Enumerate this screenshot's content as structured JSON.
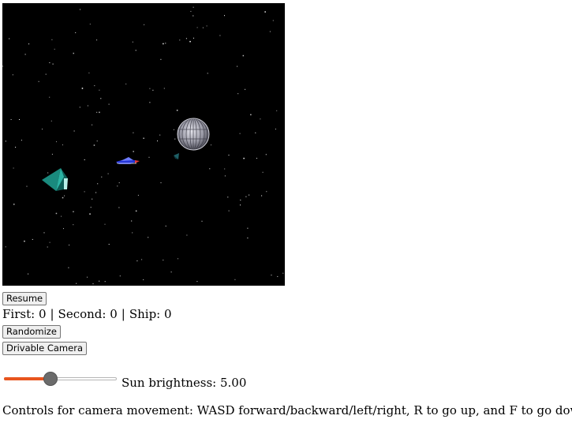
{
  "viewport": {
    "background_color": "#000000",
    "objects": [
      "planet",
      "ship",
      "pyramid",
      "small-pyramid"
    ]
  },
  "buttons": {
    "resume": "Resume",
    "randomize": "Randomize",
    "drivable_camera": "Drivable Camera"
  },
  "scores": {
    "first_label": "First:",
    "first_value": "0",
    "second_label": "Second:",
    "second_value": "0",
    "ship_label": "Ship:",
    "ship_value": "0",
    "separator": "|"
  },
  "sun": {
    "label": "Sun brightness: 5.00",
    "value": 5.0,
    "slider_fraction": 0.4,
    "accent_color": "#e8551f"
  },
  "instructions": "Controls for camera movement: WASD forward/backward/left/right, R to go up, and F to go down"
}
